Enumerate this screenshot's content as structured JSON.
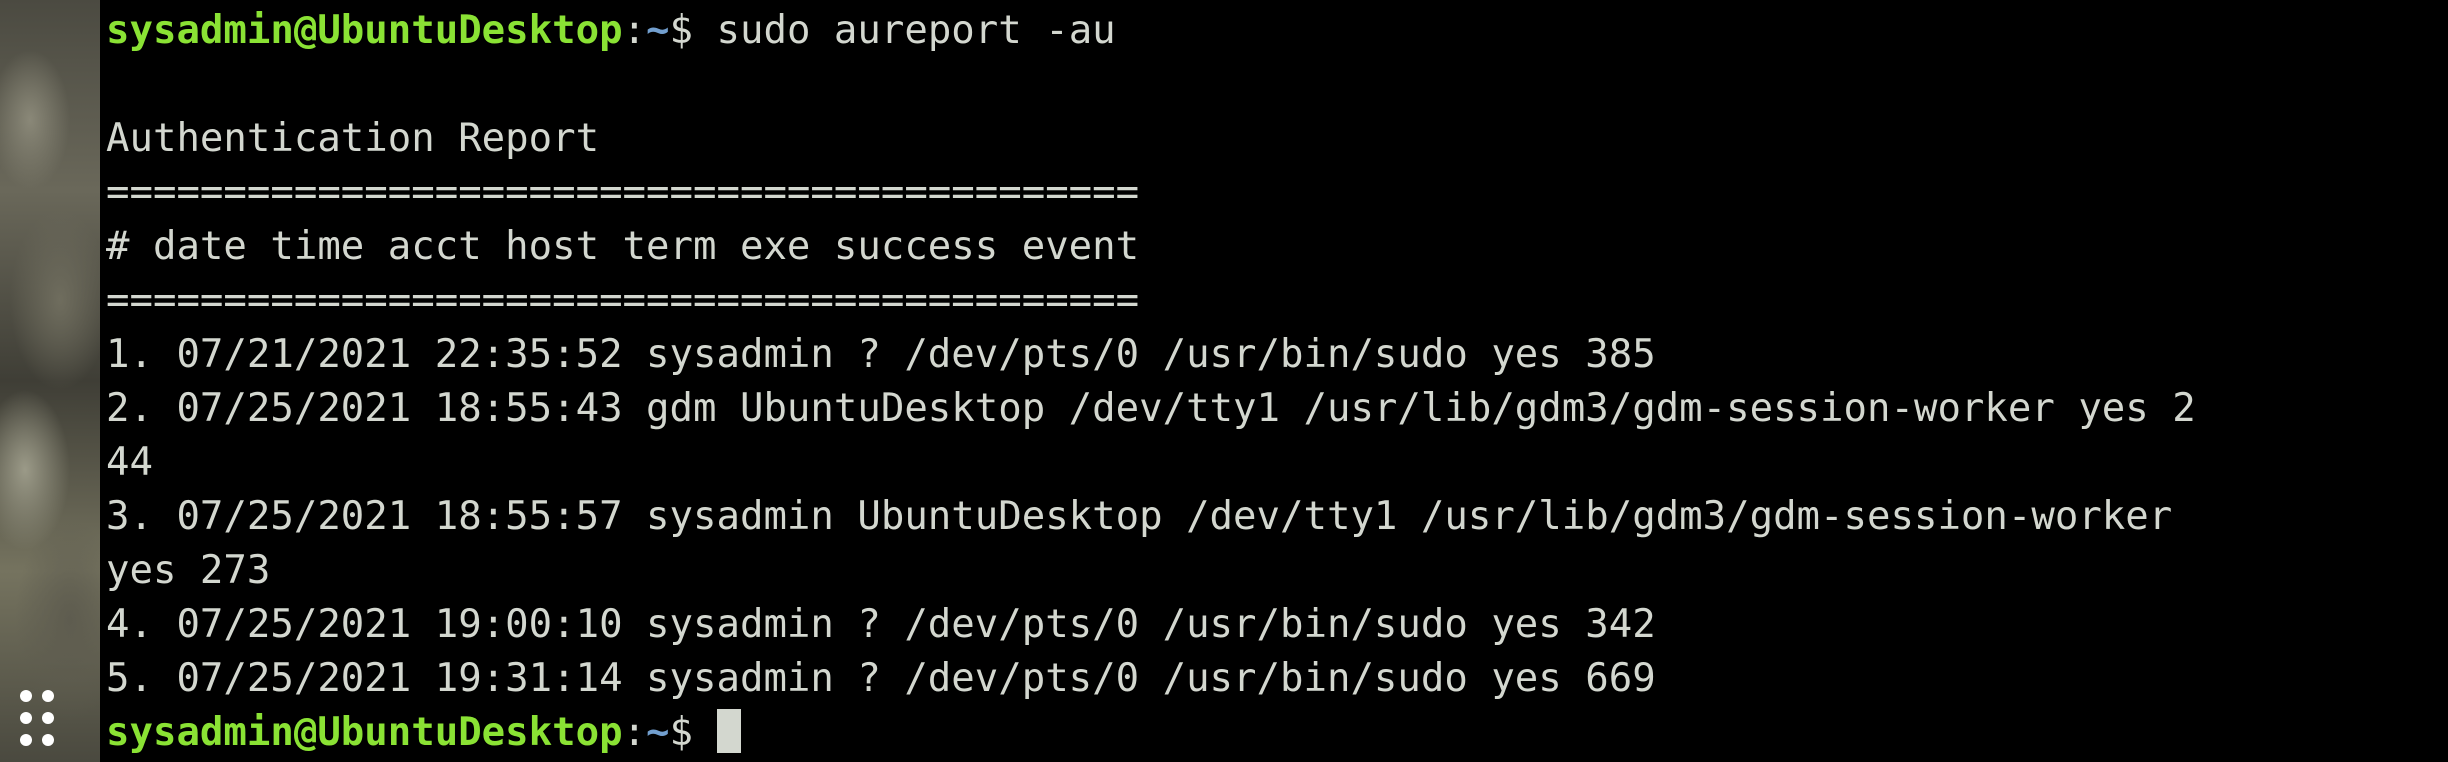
{
  "prompt_user_host": "sysadmin@UbuntuDesktop",
  "prompt_sep": ":",
  "prompt_path": "~",
  "prompt_symbol": "$ ",
  "command": "sudo aureport -au",
  "report": {
    "title": "Authentication Report",
    "separator": "============================================",
    "header": "# date time acct host term exe success event"
  },
  "output_lines": [
    "1. 07/21/2021 22:35:52 sysadmin ? /dev/pts/0 /usr/bin/sudo yes 385",
    "2. 07/25/2021 18:55:43 gdm UbuntuDesktop /dev/tty1 /usr/lib/gdm3/gdm-session-worker yes 2",
    "44",
    "3. 07/25/2021 18:55:57 sysadmin UbuntuDesktop /dev/tty1 /usr/lib/gdm3/gdm-session-worker",
    "yes 273",
    "4. 07/25/2021 19:00:10 sysadmin ? /dev/pts/0 /usr/bin/sudo yes 342",
    "5. 07/25/2021 19:31:14 sysadmin ? /dev/pts/0 /usr/bin/sudo yes 669"
  ],
  "icons": {
    "dock": "show-applications-grid-icon"
  },
  "colors": {
    "background": "#000000",
    "text": "#d3d7cf",
    "prompt_user": "#8ae234",
    "prompt_path": "#729fcf"
  }
}
